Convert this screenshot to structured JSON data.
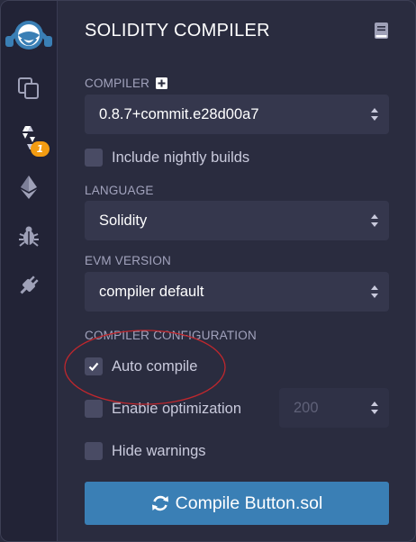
{
  "panel": {
    "title": "SOLIDITY COMPILER"
  },
  "sidebar": {
    "badge_count": "1",
    "icons": [
      "remix-logo-icon",
      "file-explorer-icon",
      "solidity-compiler-icon",
      "deploy-run-icon",
      "debugger-icon",
      "plugin-manager-icon"
    ]
  },
  "compiler": {
    "label": "COMPILER",
    "version": "0.8.7+commit.e28d00a7",
    "nightly_label": "Include nightly builds",
    "nightly_checked": false
  },
  "language": {
    "label": "LANGUAGE",
    "value": "Solidity"
  },
  "evm": {
    "label": "EVM VERSION",
    "value": "compiler default"
  },
  "config": {
    "label": "COMPILER CONFIGURATION",
    "auto_compile_label": "Auto compile",
    "auto_compile_checked": true,
    "optimization_label": "Enable optimization",
    "optimization_checked": false,
    "optimization_runs": "200",
    "hide_warnings_label": "Hide warnings",
    "hide_warnings_checked": false
  },
  "compile_button": {
    "label": "Compile Button.sol"
  },
  "colors": {
    "background": "#2a2c3f",
    "sidebar": "#222336",
    "accent_blue": "#3a7fb5",
    "badge_orange": "#f39c12",
    "annotation_red": "#c0272d"
  }
}
